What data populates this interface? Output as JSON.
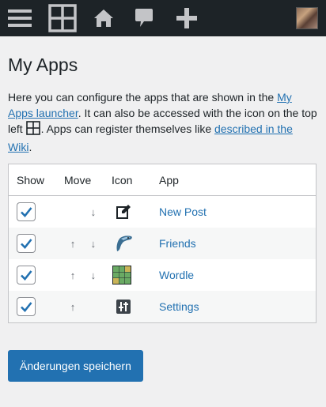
{
  "page": {
    "title": "My Apps",
    "intro_part1": "Here you can configure the apps that are shown in the ",
    "intro_link1": "My Apps launcher",
    "intro_part2": ". It can also be accessed with the icon on the top left ",
    "intro_part3": ". Apps can register themselves like ",
    "intro_link2": "described in the Wiki",
    "intro_part4": "."
  },
  "adminbar": {
    "icons": [
      "menu-icon",
      "apps-grid-icon",
      "home-icon",
      "comment-icon",
      "plus-icon"
    ],
    "bg_color": "#1d2327"
  },
  "table": {
    "headers": {
      "show": "Show",
      "move": "Move",
      "icon": "Icon",
      "app": "App"
    },
    "rows": [
      {
        "app": "New Post",
        "checked": true,
        "icon": "edit-icon",
        "up": false,
        "down": true
      },
      {
        "app": "Friends",
        "checked": true,
        "icon": "friends-bird-icon",
        "up": true,
        "down": true
      },
      {
        "app": "Wordle",
        "checked": true,
        "icon": "wordle-grid-icon",
        "up": true,
        "down": true
      },
      {
        "app": "Settings",
        "checked": true,
        "icon": "settings-sliders-icon",
        "up": true,
        "down": false
      }
    ]
  },
  "save_button": "Änderungen speichern",
  "colors": {
    "accent": "#2271b1",
    "text": "#1d2327",
    "background": "#f0f0f1"
  }
}
